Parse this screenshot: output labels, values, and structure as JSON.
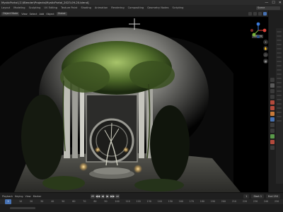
{
  "titlebar": {
    "title": "MysticPortal [C:\\Blender\\Projects\\MysticPortal_2023-09-20.blend]",
    "minimize": "—",
    "maximize": "☐",
    "close": "✕"
  },
  "workspaces": {
    "tabs": [
      "Layout",
      "Modeling",
      "Sculpting",
      "UV Editing",
      "Texture Paint",
      "Shading",
      "Animation",
      "Rendering",
      "Compositing",
      "Geometry Nodes",
      "Scripting"
    ],
    "scene": "Scene"
  },
  "viewport_header": {
    "mode": "Object Mode",
    "menus": [
      "View",
      "Select",
      "Add",
      "Object"
    ],
    "orientation": "Global",
    "options": "Options"
  },
  "nav": {
    "buttons": [
      "+",
      "✋",
      "🎥",
      "▦"
    ]
  },
  "timeline": {
    "menus": [
      "Playback",
      "Keying",
      "View",
      "Marker"
    ],
    "controls": [
      "⏮",
      "◀◀",
      "◀",
      "▶",
      "▶▶",
      "⏭"
    ],
    "current_frame": "1",
    "start_label": "Start",
    "start": "1",
    "end_label": "End",
    "end": "250",
    "ticks": [
      "0",
      "10",
      "20",
      "30",
      "40",
      "50",
      "60",
      "70",
      "80",
      "90",
      "100",
      "110",
      "120",
      "130",
      "140",
      "150",
      "160",
      "170",
      "180",
      "190",
      "200",
      "210",
      "220",
      "230",
      "240",
      "250"
    ]
  },
  "colors": {
    "accent": "#4772b3",
    "gizmo_x": "#e0433a",
    "gizmo_y": "#7ab33a",
    "gizmo_z": "#3a7ad9"
  }
}
